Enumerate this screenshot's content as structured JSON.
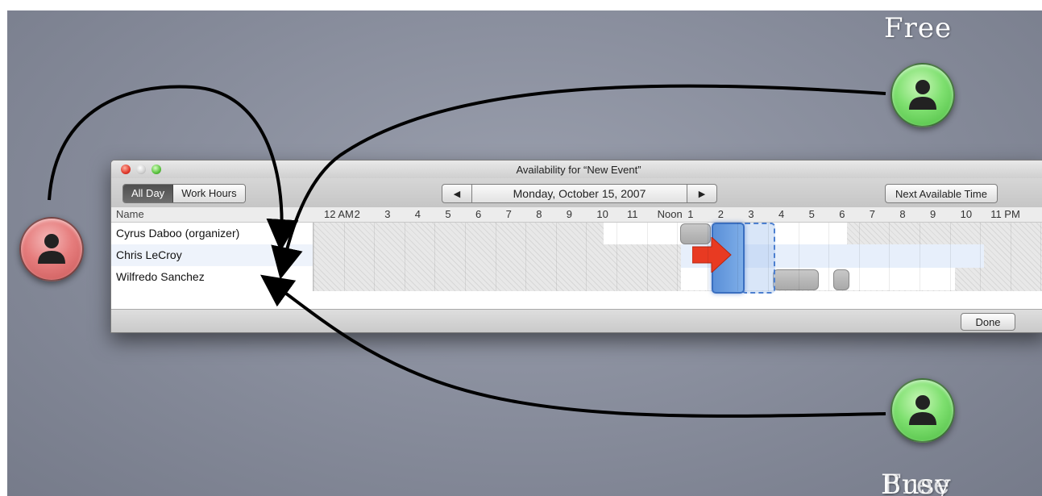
{
  "annotations": {
    "free_label": "Free",
    "busy_label_a": "Busy",
    "busy_label_b": "Free"
  },
  "window": {
    "title": "Availability for “New Event”",
    "segments": [
      "All Day",
      "Work Hours"
    ],
    "selected_segment": "All Day",
    "date": "Monday, October 15, 2007",
    "prev_icon": "◀",
    "next_icon": "▶",
    "next_available_label": "Next Available Time",
    "done_label": "Done",
    "name_header": "Name",
    "hours": [
      "12 AM",
      "2",
      "3",
      "4",
      "5",
      "6",
      "7",
      "8",
      "9",
      "10",
      "11",
      "Noon",
      "1",
      "2",
      "3",
      "4",
      "5",
      "6",
      "7",
      "8",
      "9",
      "10",
      "11 PM"
    ],
    "attendees": [
      {
        "name": "Cyrus Daboo (organizer)"
      },
      {
        "name": "Chris LeCroy"
      },
      {
        "name": "Wilfredo Sanchez"
      }
    ]
  },
  "icons": {
    "person": "person-icon",
    "traffic_close": "close-icon",
    "traffic_min": "minimize-icon",
    "traffic_zoom": "zoom-icon"
  },
  "colors": {
    "busy_person": "#e67d7d",
    "free_person": "#7fe070",
    "event_blue": "#5a8fd8",
    "arrow_red": "#e83a22"
  }
}
